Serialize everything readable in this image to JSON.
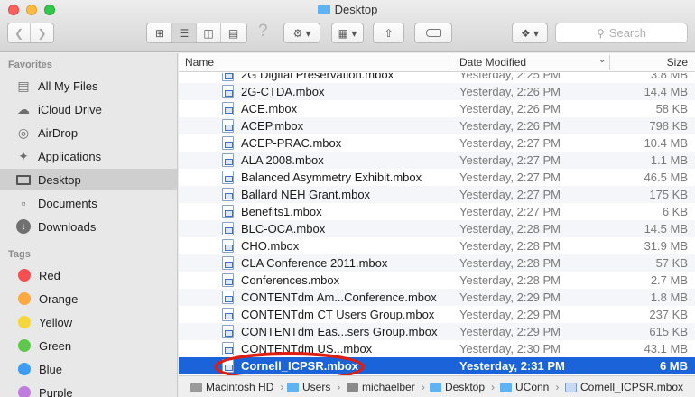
{
  "window": {
    "title": "Desktop"
  },
  "toolbar": {
    "back_icon": "chevron-left-icon",
    "forward_icon": "chevron-right-icon",
    "help_icon": "question-icon",
    "search_placeholder": "Search"
  },
  "sidebar": {
    "favorites_label": "Favorites",
    "favorites": [
      {
        "label": "All My Files",
        "icon": "all-files-icon"
      },
      {
        "label": "iCloud Drive",
        "icon": "cloud-icon"
      },
      {
        "label": "AirDrop",
        "icon": "airdrop-icon"
      },
      {
        "label": "Applications",
        "icon": "applications-icon"
      },
      {
        "label": "Desktop",
        "icon": "desktop-icon",
        "selected": true
      },
      {
        "label": "Documents",
        "icon": "documents-icon"
      },
      {
        "label": "Downloads",
        "icon": "downloads-icon"
      }
    ],
    "tags_label": "Tags",
    "tags": [
      {
        "label": "Red",
        "color": "#f5504f"
      },
      {
        "label": "Orange",
        "color": "#fba940"
      },
      {
        "label": "Yellow",
        "color": "#f5d73a"
      },
      {
        "label": "Green",
        "color": "#5dc84b"
      },
      {
        "label": "Blue",
        "color": "#3d9cf5"
      },
      {
        "label": "Purple",
        "color": "#c17ddd"
      }
    ]
  },
  "columns": {
    "name": "Name",
    "date": "Date Modified",
    "size": "Size"
  },
  "files": [
    {
      "name": "2G Digital Preservation.mbox",
      "date": "Yesterday, 2:25 PM",
      "size": "3.8 MB"
    },
    {
      "name": "2G-CTDA.mbox",
      "date": "Yesterday, 2:26 PM",
      "size": "14.4 MB"
    },
    {
      "name": "ACE.mbox",
      "date": "Yesterday, 2:26 PM",
      "size": "58 KB"
    },
    {
      "name": "ACEP.mbox",
      "date": "Yesterday, 2:26 PM",
      "size": "798 KB"
    },
    {
      "name": "ACEP-PRAC.mbox",
      "date": "Yesterday, 2:27 PM",
      "size": "10.4 MB"
    },
    {
      "name": "ALA 2008.mbox",
      "date": "Yesterday, 2:27 PM",
      "size": "1.1 MB"
    },
    {
      "name": "Balanced Asymmetry Exhibit.mbox",
      "date": "Yesterday, 2:27 PM",
      "size": "46.5 MB"
    },
    {
      "name": "Ballard NEH Grant.mbox",
      "date": "Yesterday, 2:27 PM",
      "size": "175 KB"
    },
    {
      "name": "Benefits1.mbox",
      "date": "Yesterday, 2:27 PM",
      "size": "6 KB"
    },
    {
      "name": "BLC-OCA.mbox",
      "date": "Yesterday, 2:28 PM",
      "size": "14.5 MB"
    },
    {
      "name": "CHO.mbox",
      "date": "Yesterday, 2:28 PM",
      "size": "31.9 MB"
    },
    {
      "name": "CLA Conference 2011.mbox",
      "date": "Yesterday, 2:28 PM",
      "size": "57 KB"
    },
    {
      "name": "Conferences.mbox",
      "date": "Yesterday, 2:28 PM",
      "size": "2.7 MB"
    },
    {
      "name": "CONTENTdm Am...Conference.mbox",
      "date": "Yesterday, 2:29 PM",
      "size": "1.8 MB"
    },
    {
      "name": "CONTENTdm CT Users Group.mbox",
      "date": "Yesterday, 2:29 PM",
      "size": "237 KB"
    },
    {
      "name": "CONTENTdm Eas...sers Group.mbox",
      "date": "Yesterday, 2:29 PM",
      "size": "615 KB"
    },
    {
      "name": "CONTENTdm US...mbox",
      "date": "Yesterday, 2:30 PM",
      "size": "43.1 MB"
    },
    {
      "name": "Cornell_ICPSR.mbox",
      "date": "Yesterday, 2:31 PM",
      "size": "6 MB",
      "selected": true
    }
  ],
  "pathbar": [
    {
      "label": "Macintosh HD",
      "icon": "hard-drive-icon",
      "color": "#9a9a9a"
    },
    {
      "label": "Users",
      "icon": "folder-icon",
      "color": "#5fb3f2"
    },
    {
      "label": "michaelber",
      "icon": "home-icon",
      "color": "#8a8a8a"
    },
    {
      "label": "Desktop",
      "icon": "folder-icon",
      "color": "#5fb3f2"
    },
    {
      "label": "UConn",
      "icon": "folder-icon",
      "color": "#5fb3f2"
    },
    {
      "label": "Cornell_ICPSR.mbox",
      "icon": "mbox-icon",
      "color": "#c9d9f2"
    }
  ]
}
